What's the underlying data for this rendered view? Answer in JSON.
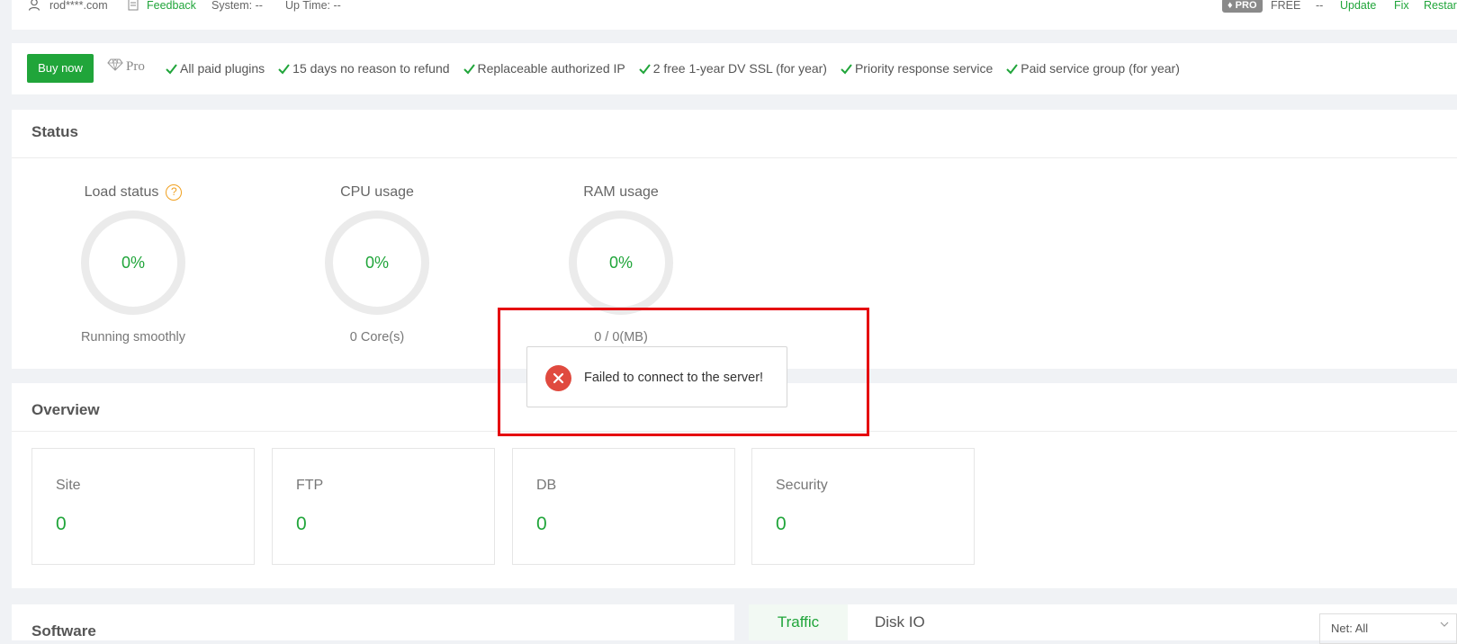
{
  "topbar": {
    "user": "rod****.com",
    "feedback": "Feedback",
    "system": "System: --",
    "uptime": "Up Time: --",
    "pro_badge": "PRO",
    "free": "FREE",
    "version": "--",
    "update": "Update",
    "fix": "Fix",
    "restart": "Restar"
  },
  "promo": {
    "buy_label": "Buy now",
    "pro_label": "Pro",
    "features": [
      "All paid plugins",
      "15 days no reason to refund",
      "Replaceable authorized IP",
      "2 free 1-year DV SSL (for year)",
      "Priority response service",
      "Paid service group (for year)"
    ]
  },
  "status": {
    "title": "Status",
    "gauges": [
      {
        "title": "Load status",
        "value": "0%",
        "sub": "Running smoothly"
      },
      {
        "title": "CPU usage",
        "value": "0%",
        "sub": "0 Core(s)"
      },
      {
        "title": "RAM usage",
        "value": "0%",
        "sub": "0 / 0(MB)"
      }
    ],
    "help_glyph": "?"
  },
  "overview": {
    "title": "Overview",
    "cards": [
      {
        "label": "Site",
        "value": "0"
      },
      {
        "label": "FTP",
        "value": "0"
      },
      {
        "label": "DB",
        "value": "0"
      },
      {
        "label": "Security",
        "value": "0"
      }
    ]
  },
  "software": {
    "title": "Software"
  },
  "traffic": {
    "tabs": [
      "Traffic",
      "Disk IO"
    ],
    "net_select": "Net: All"
  },
  "toast": {
    "message": "Failed to connect to the server!"
  },
  "colors": {
    "accent": "#20a53a",
    "error": "#e04a3f",
    "highlight": "#e5000e"
  }
}
